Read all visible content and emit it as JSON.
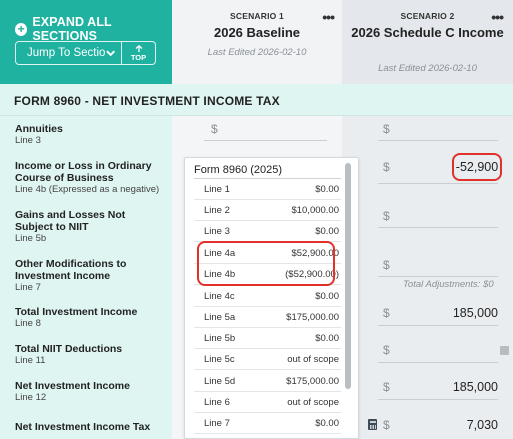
{
  "header": {
    "expand_all": "EXPAND ALL SECTIONS",
    "jump_to_section": "Jump To Section",
    "top_label": "TOP"
  },
  "scenarios": [
    {
      "label": "SCENARIO 1",
      "name": "2026 Baseline",
      "edited": "Last Edited 2026-02-10"
    },
    {
      "label": "SCENARIO 2",
      "name": "2026 Schedule C Income",
      "edited": "Last Edited 2026-02-10"
    }
  ],
  "section": {
    "title": "FORM 8960 - NET INVESTMENT INCOME TAX"
  },
  "rows": [
    {
      "title": "Annuities",
      "sub": "Line 3"
    },
    {
      "title": "Income or Loss in Ordinary Course of Business",
      "sub": "Line 4b (Expressed as a negative)"
    },
    {
      "title": "Gains and Losses Not Subject to NIIT",
      "sub": "Line 5b"
    },
    {
      "title": "Other Modifications to Investment Income",
      "sub": "Line 7"
    },
    {
      "title": "Total Investment Income",
      "sub": "Line 8"
    },
    {
      "title": "Total NIIT Deductions",
      "sub": "Line 11"
    },
    {
      "title": "Net Investment Income",
      "sub": "Line 12"
    },
    {
      "title": "Net Investment Income Tax",
      "sub": ""
    }
  ],
  "currency_symbol": "$",
  "scenario2_values": {
    "income_loss_business": "-52,900",
    "total_adjustments": "Total Adjustments: $0",
    "total_investment_income": "185,000",
    "net_investment_income": "185,000",
    "niit": "7,030"
  },
  "popup": {
    "title": "Form 8960 (2025)",
    "lines": [
      {
        "name": "Line 1",
        "value": "$0.00"
      },
      {
        "name": "Line 2",
        "value": "$10,000.00"
      },
      {
        "name": "Line 3",
        "value": "$0.00"
      },
      {
        "name": "Line 4a",
        "value": "$52,900.00"
      },
      {
        "name": "Line 4b",
        "value": "($52,900.00)"
      },
      {
        "name": "Line 4c",
        "value": "$0.00"
      },
      {
        "name": "Line 5a",
        "value": "$175,000.00"
      },
      {
        "name": "Line 5b",
        "value": "$0.00"
      },
      {
        "name": "Line 5c",
        "value": "out of scope"
      },
      {
        "name": "Line 5d",
        "value": "$175,000.00"
      },
      {
        "name": "Line 6",
        "value": "out of scope"
      },
      {
        "name": "Line 7",
        "value": "$0.00"
      }
    ]
  },
  "colors": {
    "teal": "#20b2a0",
    "light_teal": "#dff5f2",
    "highlight_red": "#e0312b"
  }
}
